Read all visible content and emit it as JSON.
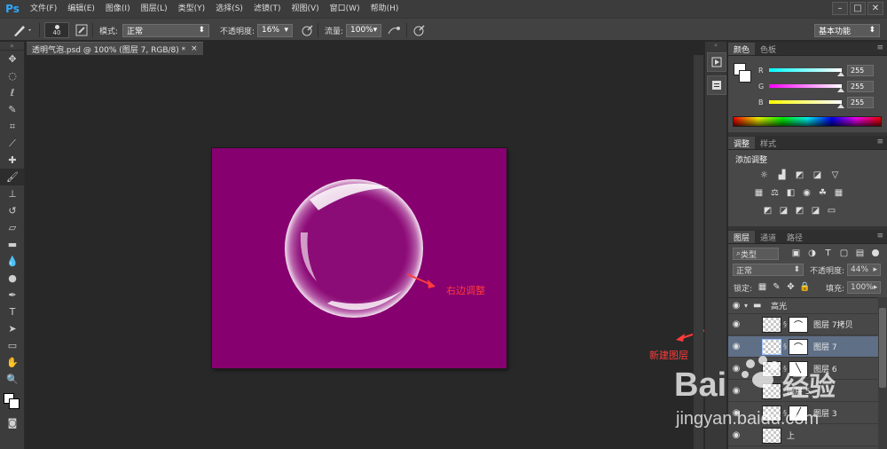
{
  "app": {
    "logo": "Ps"
  },
  "menu": [
    "文件(F)",
    "编辑(E)",
    "图像(I)",
    "图层(L)",
    "类型(Y)",
    "选择(S)",
    "滤镜(T)",
    "视图(V)",
    "窗口(W)",
    "帮助(H)"
  ],
  "window_controls": [
    "–",
    "□",
    "✕"
  ],
  "options": {
    "brush_size": "40",
    "mode_label": "模式:",
    "mode_value": "正常",
    "opacity_label": "不透明度:",
    "opacity_value": "16%",
    "flow_label": "流量:",
    "flow_value": "100%",
    "workspace": "基本功能"
  },
  "document": {
    "tab_title": "透明气泡.psd @ 100% (图层 7, RGB/8) *",
    "close": "×",
    "bg_color": "#86006f",
    "annotation_right": "右边调整",
    "annotation_new_layer": "新建图层"
  },
  "tools": [
    "move-tool",
    "marquee-tool",
    "lasso-tool",
    "quick-select-tool",
    "crop-tool",
    "eyedropper-tool",
    "spot-heal-tool",
    "brush-tool",
    "clone-stamp-tool",
    "history-brush-tool",
    "eraser-tool",
    "gradient-tool",
    "blur-tool",
    "dodge-tool",
    "pen-tool",
    "type-tool",
    "path-select-tool",
    "rectangle-tool",
    "hand-tool",
    "zoom-tool"
  ],
  "color_panel": {
    "tabs": [
      "颜色",
      "色板"
    ],
    "r_label": "R",
    "r_value": "255",
    "g_label": "G",
    "g_value": "255",
    "b_label": "B",
    "b_value": "255"
  },
  "adjustments_panel": {
    "tabs": [
      "调整",
      "样式"
    ],
    "title": "添加调整"
  },
  "layers_panel": {
    "tabs": [
      "图层",
      "通道",
      "路径"
    ],
    "filter_kind": "类型",
    "blend_mode": "正常",
    "opacity_label": "不透明度:",
    "opacity_value": "44%",
    "lock_label": "锁定:",
    "fill_label": "填充:",
    "fill_value": "100%",
    "layers": [
      {
        "name": "高光",
        "type": "group"
      },
      {
        "name": "图层 7拷贝",
        "type": "layer"
      },
      {
        "name": "图层 7",
        "type": "layer",
        "selected": true
      },
      {
        "name": "图层 6",
        "type": "layer"
      },
      {
        "name": "图层 5",
        "type": "layer"
      },
      {
        "name": "图层 3",
        "type": "layer"
      },
      {
        "name": "上",
        "type": "layer"
      }
    ]
  },
  "watermark": {
    "brand": "Bai",
    "brand2": "经验",
    "url": "jingyan.baidu.com"
  },
  "colors": {
    "accent": "#31a8ff",
    "annotation": "#ff3b3b",
    "selection": "#5f6f86"
  }
}
